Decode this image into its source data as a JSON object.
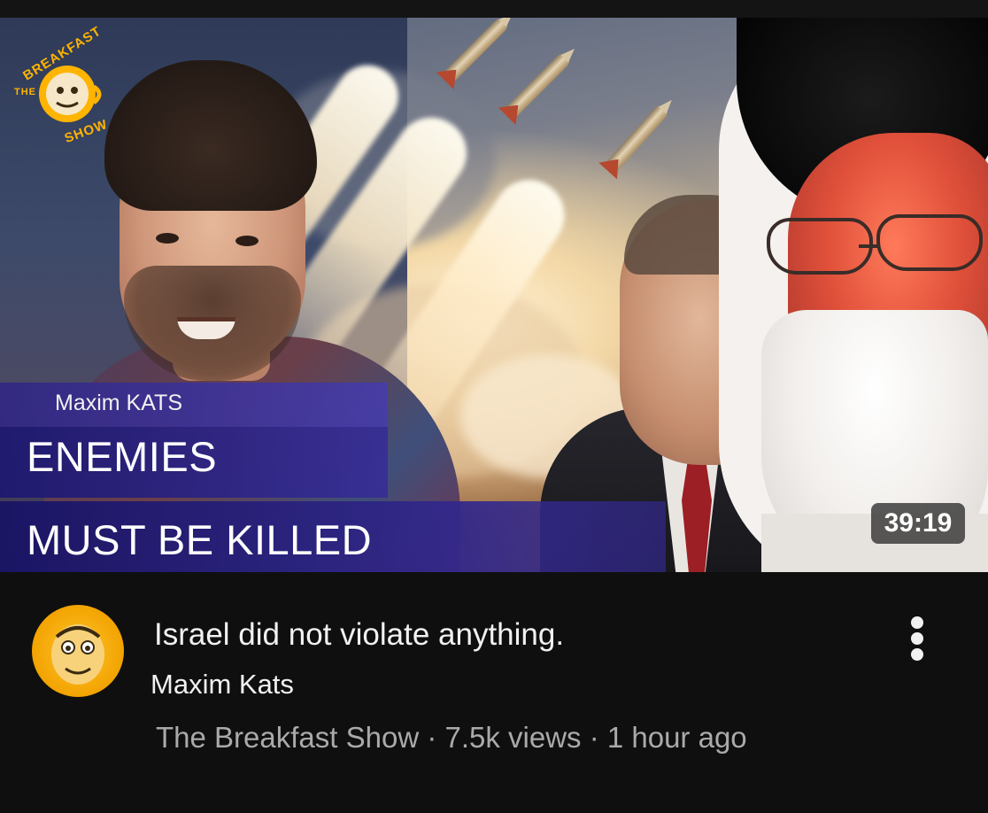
{
  "thumbnail": {
    "logo_text_top": "BREAKFAST",
    "logo_text_the": "THE",
    "logo_text_bottom": "SHOW",
    "overlay_name": "Maxim KATS",
    "overlay_line1": "ENEMIES",
    "overlay_line2": "MUST BE KILLED",
    "duration": "39:19"
  },
  "video": {
    "title": "Israel did not violate anything.",
    "channel": "Maxim Kats",
    "meta": "The Breakfast Show · 7.5k views · 1 hour ago"
  },
  "icons": {
    "menu": "more-vert-icon"
  },
  "colors": {
    "background": "#0f0f0f",
    "secondary_text": "#aaaaaa",
    "overlay_bar": "#2e2680",
    "logo_yellow": "#ffb400"
  }
}
